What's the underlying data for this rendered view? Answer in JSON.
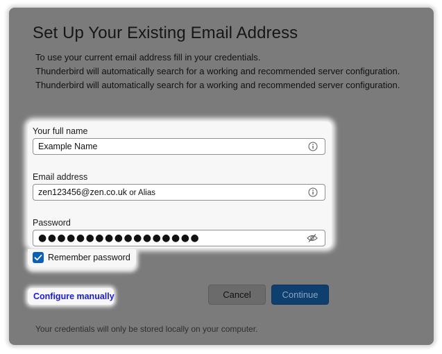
{
  "dialog": {
    "title": "Set Up Your Existing Email Address",
    "description": [
      "To use your current email address fill in your credentials.",
      "Thunderbird will automatically search for a working and recommended server configuration.",
      "Thunderbird will automatically search for a working and recommended server configuration."
    ]
  },
  "form": {
    "full_name": {
      "label": "Your full name",
      "value": "Example Name",
      "icon": "info-icon"
    },
    "email": {
      "label": "Email address",
      "value": "zen123456@zen.co.uk",
      "value_suffix": " or Alias",
      "icon": "info-icon"
    },
    "password": {
      "label": "Password",
      "value": "●●●●●●●●●●●●●●●●●",
      "icon": "eye-slash-icon"
    },
    "remember": {
      "label": "Remember password",
      "checked": true
    }
  },
  "actions": {
    "configure_manually": "Configure manually",
    "cancel": "Cancel",
    "continue": "Continue"
  },
  "footer": "Your credentials will only be stored locally on your computer.",
  "colors": {
    "dialog_bg": "#7b7b7b",
    "link": "#1a1ad6",
    "checkbox": "#0a5fb6",
    "continue_bg": "#0f3f6e"
  }
}
